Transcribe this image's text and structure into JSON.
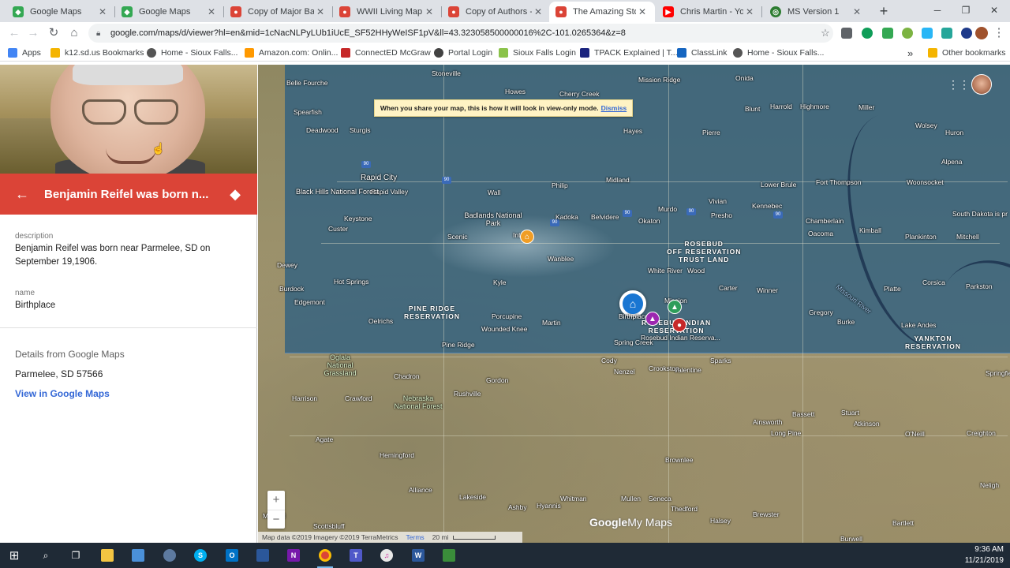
{
  "browser": {
    "tabs": [
      {
        "label": "Google Maps",
        "color": "#34a853",
        "active": false
      },
      {
        "label": "Google Maps",
        "color": "#34a853",
        "active": false
      },
      {
        "label": "Copy of Major Battl",
        "color": "#db4437",
        "active": false
      },
      {
        "label": "WWII Living Map - (",
        "color": "#db4437",
        "active": false
      },
      {
        "label": "Copy of Authors - G",
        "color": "#db4437",
        "active": false
      },
      {
        "label": "The Amazing Story o",
        "color": "#db4437",
        "active": true
      },
      {
        "label": "Chris Martin - YouTu",
        "color": "#ff0000",
        "active": false
      },
      {
        "label": "MS Version 1",
        "color": "#2e7d32",
        "active": false
      }
    ],
    "url": "google.com/maps/d/viewer?hl=en&mid=1cNacNLPyLUb1iUcE_SF52HHyWeISF1pV&ll=43.323058500000016%2C-101.0265364&z=8",
    "bookmarks": [
      {
        "label": "Apps",
        "color": "#4285f4"
      },
      {
        "label": "k12.sd.us Bookmarks",
        "color": "#f4b400"
      },
      {
        "label": "Home - Sioux Falls...",
        "color": "#555555"
      },
      {
        "label": "Amazon.com: Onlin...",
        "color": "#ff9900"
      },
      {
        "label": "ConnectED McGraw",
        "color": "#c62828"
      },
      {
        "label": "Portal Login",
        "color": "#424242"
      },
      {
        "label": "Sioux Falls Login",
        "color": "#8bc34a"
      },
      {
        "label": "TPACK Explained | T...",
        "color": "#1a237e"
      },
      {
        "label": "ClassLink",
        "color": "#1565c0"
      },
      {
        "label": "Home - Sioux Falls...",
        "color": "#555555"
      }
    ],
    "other_bookmarks": "Other bookmarks",
    "overflow": "»"
  },
  "panel": {
    "title": "Benjamin Reifel was born n...",
    "description_label": "description",
    "description_value": "Benjamin Reifel was born near Parmelee, SD on September 19,1906.",
    "name_label": "name",
    "name_value": "Birthplace",
    "details_title": "Details from Google Maps",
    "address": "Parmelee, SD 57566",
    "view_link": "View in Google Maps"
  },
  "map": {
    "banner_text": "When you share your map, this is how it will look in view-only mode.",
    "banner_dismiss": "Dismiss",
    "places": [
      "Belle Fourche",
      "Stoneville",
      "Howes",
      "Cherry Creek",
      "Mission Ridge",
      "Onida",
      "Harrold",
      "Highmore",
      "Miller",
      "Blunt",
      "Spearfish",
      "Deadwood",
      "Sturgis",
      "Hayes",
      "Pierre",
      "Wolsey",
      "Huron",
      "Alpena",
      "Rapid City",
      "Rapid Valley",
      "Philip",
      "Midland",
      "Fort Thompson",
      "Lower Brule",
      "Woonsocket",
      "Black Hills National Forest",
      "Wall",
      "Kadoka",
      "Belvidere",
      "Murdo",
      "Vivian",
      "Presho",
      "Kennebec",
      "Chamberlain",
      "Oacoma",
      "Kimball",
      "Plankinton",
      "Mitchell",
      "Keystone",
      "Custer",
      "Badlands National Park",
      "Scenic",
      "Interior",
      "Okaton",
      "Wanblee",
      "White River",
      "Wood",
      "Hot Springs",
      "Edgemont",
      "Dewey",
      "Burdock",
      "Kyle",
      "Carter",
      "Winner",
      "Platte",
      "Corsica",
      "Parkston",
      "Oelrichs",
      "Porcupine",
      "Wounded Knee",
      "Martin",
      "Pine Ridge",
      "Spring Creek",
      "Gregory",
      "Burke",
      "Lake Andes",
      "Mission",
      "Cody",
      "Sparks",
      "Valentine",
      "Nenzel",
      "Crookston",
      "Springfield",
      "Chadron",
      "Gordon",
      "Rushville",
      "Harrison",
      "Crawford",
      "Ainsworth",
      "Bassett",
      "Stuart",
      "Atkinson",
      "O'Neill",
      "Creighton",
      "Long Pine",
      "Agate",
      "Hemingford",
      "Brownlee",
      "Neligh",
      "Alliance",
      "Lakeside",
      "Whitman",
      "Mullen",
      "Seneca",
      "Thedford",
      "Halsey",
      "Brewster",
      "Bartlett",
      "Hyannis",
      "Ashby",
      "Mitchell",
      "Scottsbluff",
      "Burwell",
      "Sturgis"
    ],
    "regions": [
      "ROSEBUD\nOFF RESERVATION\nTRUST LAND",
      "PINE RIDGE\nRESERVATION",
      "ROSEBUD INDIAN\nRESERVATION",
      "YANKTON\nRESERVATION"
    ],
    "forests": [
      "Oglala National Grassland",
      "Nebraska National Forest"
    ],
    "river": "Missouri River",
    "state_label": "South Dakota is pr",
    "marker_label_home": "Birthplace",
    "marker_label_red": "Rosebud Indian Reserva...",
    "attribution": "Map data ©2019 Imagery ©2019 TerraMetrics",
    "terms": "Terms",
    "scale": "20 mi",
    "logo_google": "Google",
    "logo_mymaps": "My Maps",
    "zoom_in": "+",
    "zoom_out": "−"
  },
  "taskbar": {
    "time": "9:36 AM",
    "date": "11/21/2019"
  }
}
